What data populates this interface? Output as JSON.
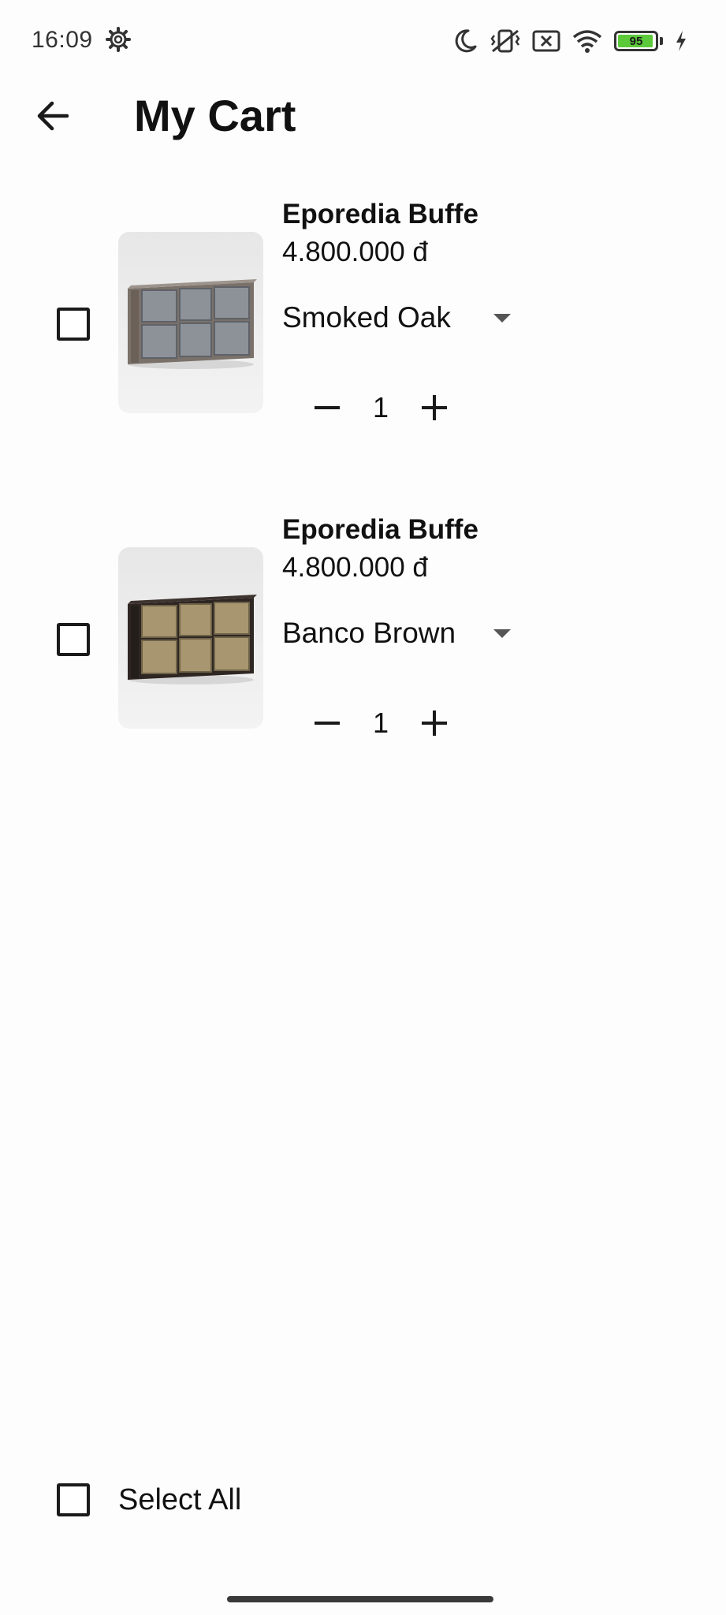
{
  "status_bar": {
    "time": "16:09",
    "battery_level": "95",
    "icons": [
      "settings-gear-icon",
      "moon-icon",
      "vibrate-off-icon",
      "sim-x-icon",
      "wifi-icon",
      "battery-icon",
      "charging-bolt-icon"
    ]
  },
  "header": {
    "back_icon": "arrow-left-icon",
    "title": "My Cart"
  },
  "cart": {
    "items": [
      {
        "name": "Eporedia Buffe",
        "price": "4.800.000 đ",
        "variant": "Smoked Oak",
        "quantity": "1",
        "checked": false,
        "image": "gray sideboard"
      },
      {
        "name": "Eporedia Buffe",
        "price": "4.800.000 đ",
        "variant": "Banco Brown",
        "quantity": "1",
        "checked": false,
        "image": "brass sideboard"
      }
    ]
  },
  "footer": {
    "select_all_label": "Select All",
    "select_all_checked": false
  },
  "colors": {
    "background": "#fdfdfd",
    "text": "#111111",
    "battery_fill": "#5cc93a"
  }
}
